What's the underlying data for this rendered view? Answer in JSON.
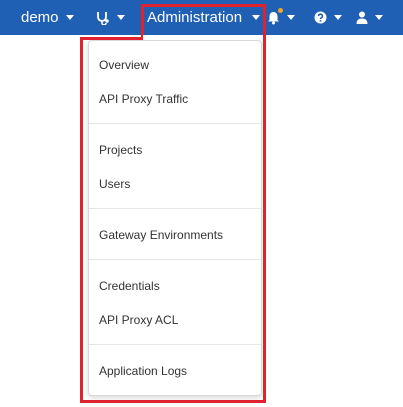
{
  "navbar": {
    "demo_label": "demo",
    "admin_label": "Administration",
    "icons": {
      "stethoscope": "stethoscope-icon",
      "bell": "bell-icon",
      "help": "help-icon",
      "user": "user-icon"
    },
    "notification_dot_color": "#f5a623",
    "background_color": "#1f5fb4"
  },
  "admin_menu": {
    "items": [
      "Overview",
      "API Proxy Traffic",
      "Projects",
      "Users",
      "Gateway Environments",
      "Credentials",
      "API Proxy ACL",
      "Application Logs"
    ]
  },
  "highlight_color": "#e0222f"
}
